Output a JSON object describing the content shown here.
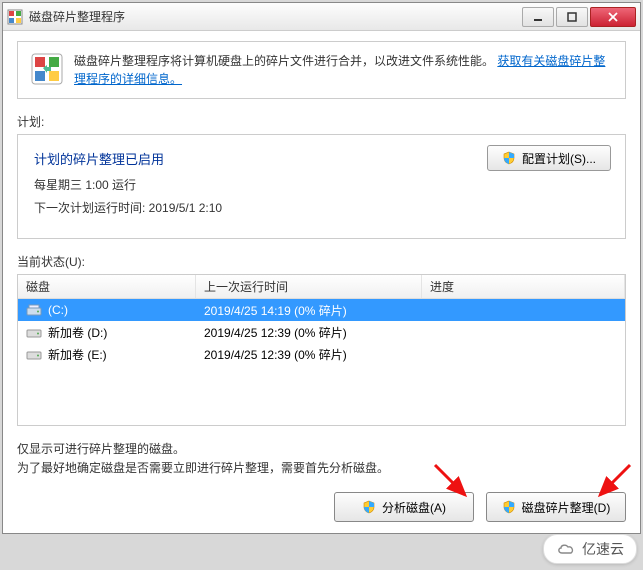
{
  "titlebar": {
    "title": "磁盘碎片整理程序"
  },
  "info": {
    "text": "磁盘碎片整理程序将计算机硬盘上的碎片文件进行合并，以改进文件系统性能。",
    "link": "获取有关磁盘碎片整理程序的详细信息。"
  },
  "schedule": {
    "label": "计划:",
    "title": "计划的碎片整理已启用",
    "line1": "每星期三  1:00 运行",
    "line2": "下一次计划运行时间: 2019/5/1 2:10",
    "config_label": "配置计划(S)..."
  },
  "status": {
    "label": "当前状态(U):"
  },
  "table": {
    "headers": {
      "h1": "磁盘",
      "h2": "上一次运行时间",
      "h3": "进度"
    },
    "rows": [
      {
        "name": "(C:)",
        "lastrun": "2019/4/25 14:19 (0% 碎片)",
        "progress": "",
        "selected": true,
        "icon": "drive-c"
      },
      {
        "name": "新加卷 (D:)",
        "lastrun": "2019/4/25 12:39 (0% 碎片)",
        "progress": "",
        "selected": false,
        "icon": "drive"
      },
      {
        "name": "新加卷 (E:)",
        "lastrun": "2019/4/25 12:39 (0% 碎片)",
        "progress": "",
        "selected": false,
        "icon": "drive"
      }
    ]
  },
  "bottom": {
    "line1": "仅显示可进行碎片整理的磁盘。",
    "line2": "为了最好地确定磁盘是否需要立即进行碎片整理，需要首先分析磁盘。",
    "analyze": "分析磁盘(A)",
    "defrag": "磁盘碎片整理(D)"
  },
  "watermark": {
    "text": "亿速云"
  }
}
